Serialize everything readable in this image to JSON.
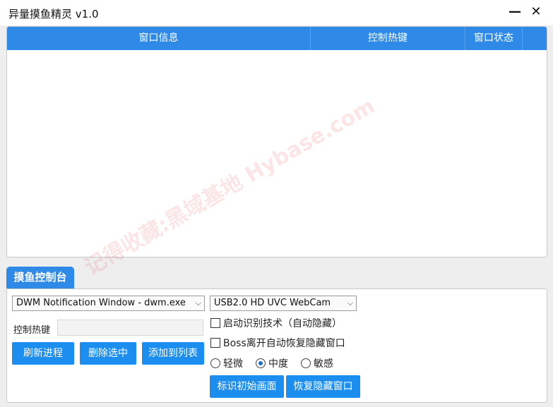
{
  "window": {
    "title": "异量摸鱼精灵 v1.0",
    "minimize_glyph": "—",
    "close_glyph": "✕"
  },
  "list": {
    "columns": [
      "窗口信息",
      "控制热键",
      "窗口状态"
    ]
  },
  "console": {
    "tab_label": "摸鱼控制台",
    "process_select_value": "DWM Notification Window - dwm.exe",
    "camera_select_value": "USB2.0 HD UVC WebCam",
    "hotkey_label": "控制热键",
    "hotkey_value": "",
    "buttons": {
      "refresh": "刷新进程",
      "delete": "删除选中",
      "add": "添加到列表",
      "mark": "标识初始画面",
      "restore": "恢复隐藏窗口"
    },
    "checkboxes": {
      "enable_recognition": "启动识别技术（自动隐藏）",
      "auto_restore": "Boss离开自动恢复隐藏窗口"
    },
    "sensitivity": {
      "options": [
        "轻微",
        "中度",
        "敏感"
      ],
      "selected": "中度"
    }
  },
  "watermark": {
    "text": "记得收藏:黑域基地 Hybase.com"
  },
  "colors": {
    "accent": "#2e8ae6",
    "button": "#1b8ef0"
  }
}
